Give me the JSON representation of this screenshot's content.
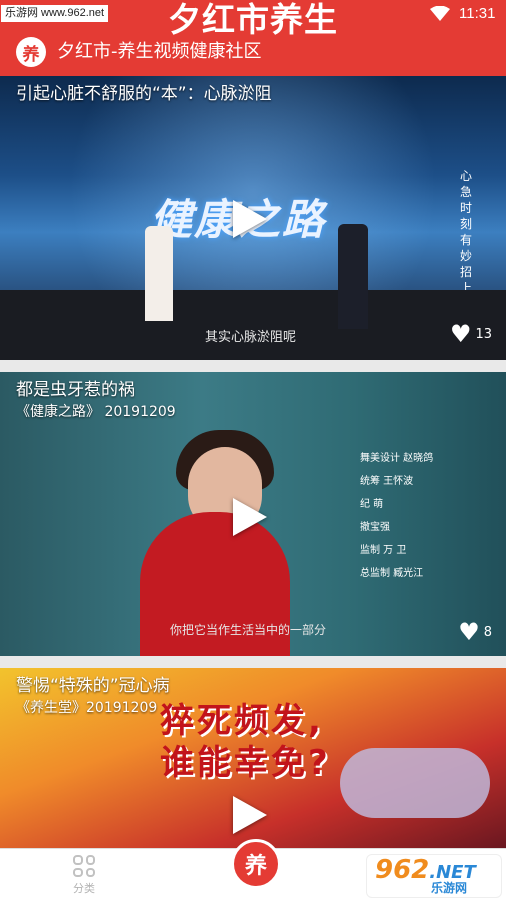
{
  "header": {
    "watermark": "乐游网 www.962.net",
    "app_title": "夕红市养生",
    "time": "11:31",
    "logo_char": "养",
    "subtitle": "夕红市-养生视频健康社区"
  },
  "feed": [
    {
      "title": "引起心脏不舒服的“本”：心脉淤阻",
      "overlay_show": "健康之路",
      "overlay_caption": "其实心脉淤阻呢",
      "overlay_vertical": "心急时刻有妙招 上",
      "likes": "13"
    },
    {
      "title": "都是虫牙惹的祸",
      "subtitle": "《健康之路》 20191209",
      "overlay_credits": [
        "舞美设计 赵晓鸽",
        "统筹 王怀波",
        "纪 萌",
        "撤宝强",
        "监制 万 卫",
        "总监制 臧光江"
      ],
      "overlay_caption": "你把它当作生活当中的一部分",
      "likes": "8"
    },
    {
      "title": "警惕“特殊的”冠心病",
      "subtitle": "《养生堂》20191209",
      "overlay_banner_line1": "猝死频发,",
      "overlay_banner_line2": "谁能幸免?"
    }
  ],
  "bottom_nav": {
    "category_label": "分类",
    "home_char": "养"
  },
  "watermark_962": {
    "big": "962",
    "net": ".NET",
    "small": "乐游网"
  },
  "icons": {
    "category": "grid-icon",
    "play": "play-icon",
    "like": "heart-icon",
    "wifi": "wifi-icon"
  },
  "colors": {
    "brand_red": "#e43b34"
  }
}
